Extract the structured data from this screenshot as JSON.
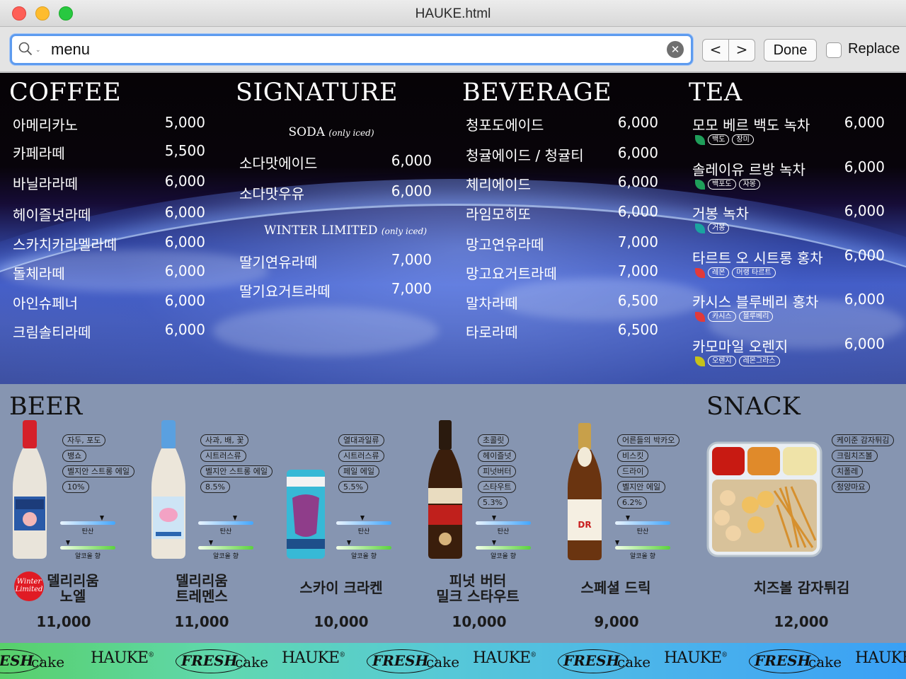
{
  "window": {
    "title": "HAUKE.html"
  },
  "find": {
    "query": "menu",
    "prev": "<",
    "next": ">",
    "done": "Done",
    "replace": "Replace"
  },
  "coffee": {
    "title": "COFFEE",
    "items": [
      {
        "name": "아메리카노",
        "price": "5,000"
      },
      {
        "name": "카페라떼",
        "price": "5,500"
      },
      {
        "name": "바닐라라떼",
        "price": "6,000"
      },
      {
        "name": "헤이즐넛라떼",
        "price": "6,000"
      },
      {
        "name": "스카치카라멜라떼",
        "price": "6,000"
      },
      {
        "name": "돌체라떼",
        "price": "6,000"
      },
      {
        "name": "아인슈페너",
        "price": "6,000"
      },
      {
        "name": "크림솔티라떼",
        "price": "6,000"
      }
    ]
  },
  "signature": {
    "title": "SIGNATURE",
    "soda_head": "SODA",
    "soda_note": "(only iced)",
    "soda_items": [
      {
        "name": "소다맛에이드",
        "price": "6,000"
      },
      {
        "name": "소다맛우유",
        "price": "6,000"
      }
    ],
    "winter_head": "WINTER LIMITED",
    "winter_note": "(only iced)",
    "winter_items": [
      {
        "name": "딸기연유라떼",
        "price": "7,000"
      },
      {
        "name": "딸기요거트라떼",
        "price": "7,000"
      }
    ]
  },
  "beverage": {
    "title": "BEVERAGE",
    "items": [
      {
        "name": "청포도에이드",
        "price": "6,000"
      },
      {
        "name": "청귤에이드 / 청귤티",
        "price": "6,000"
      },
      {
        "name": "체리에이드",
        "price": "6,000"
      },
      {
        "name": "라임모히또",
        "price": "6,000"
      },
      {
        "name": "망고연유라떼",
        "price": "7,000"
      },
      {
        "name": "망고요거트라떼",
        "price": "7,000"
      },
      {
        "name": "말차라떼",
        "price": "6,500"
      },
      {
        "name": "타로라떼",
        "price": "6,500"
      }
    ]
  },
  "tea": {
    "title": "TEA",
    "items": [
      {
        "name": "모모 베르 백도 녹차",
        "price": "6,000",
        "leaf": "#1f9e5a",
        "tags": [
          "백도",
          "장미"
        ]
      },
      {
        "name": "솔레이유 르방 녹차",
        "price": "6,000",
        "leaf": "#1f9e5a",
        "tags": [
          "백포도",
          "자몽"
        ]
      },
      {
        "name": "거봉 녹차",
        "price": "6,000",
        "leaf": "#1aa4a0",
        "tags": [
          "거봉"
        ]
      },
      {
        "name": "타르트 오 시트롱 홍차",
        "price": "6,000",
        "leaf": "#e23a3a",
        "tags": [
          "레몬",
          "머랭 타르트"
        ]
      },
      {
        "name": "카시스 블루베리 홍차",
        "price": "6,000",
        "leaf": "#e23a3a",
        "tags": [
          "카시스",
          "블루베리"
        ]
      },
      {
        "name": "카모마일 오렌지",
        "price": "6,000",
        "leaf": "#c6c21a",
        "tags": [
          "오렌지",
          "레몬그라스"
        ]
      }
    ]
  },
  "beer": {
    "title": "BEER",
    "meter_labels": {
      "carbonation": "탄산",
      "alcohol": "알코올 향"
    },
    "items": [
      {
        "name_line1": "델리리움",
        "name_line2": "노엘",
        "price": "11,000",
        "tags": [
          "자두, 포도",
          "뱅쇼",
          "벨지안 스트롱 에일",
          "10%"
        ],
        "carbonation": 0.75,
        "alcohol": 0.1,
        "winter": true
      },
      {
        "name_line1": "델리리움",
        "name_line2": "트레멘스",
        "price": "11,000",
        "tags": [
          "사과, 배, 꽃",
          "시트러스류",
          "벨지안 스트롱 에일",
          "8.5%"
        ],
        "carbonation": 0.65,
        "alcohol": 0.2,
        "winter": false
      },
      {
        "name_line1": "스카이 크라켄",
        "name_line2": "",
        "price": "10,000",
        "tags": [
          "열대과일류",
          "시트러스류",
          "페일 에일",
          "5.5%"
        ],
        "carbonation": 0.45,
        "alcohol": 0.2,
        "winter": false
      },
      {
        "name_line1": "피넛 버터",
        "name_line2": "밀크 스타우트",
        "price": "10,000",
        "tags": [
          "초콜릿",
          "헤이즐넛",
          "피넛버터",
          "스타우트",
          "5.3%"
        ],
        "carbonation": 0.3,
        "alcohol": 0.3,
        "winter": false
      },
      {
        "name_line1": "스페셜 드릭",
        "name_line2": "",
        "price": "9,000",
        "tags": [
          "어른들의 박카오",
          "비스킷",
          "드라이",
          "벨지안 에일",
          "6.2%"
        ],
        "carbonation": 0.2,
        "alcohol": 0.0,
        "winter": false
      }
    ],
    "winter_badge": [
      "Winter",
      "Limited"
    ]
  },
  "snack": {
    "title": "SNACK",
    "name": "치즈볼 감자튀김",
    "price": "12,000",
    "tags": [
      "케이준 감자튀김",
      "크림치즈볼",
      "치폴레",
      "청양마요"
    ]
  },
  "marquee": {
    "fresh": "FRESH",
    "cake": "cake",
    "hauke": "HAUKE",
    "reg": "®"
  }
}
